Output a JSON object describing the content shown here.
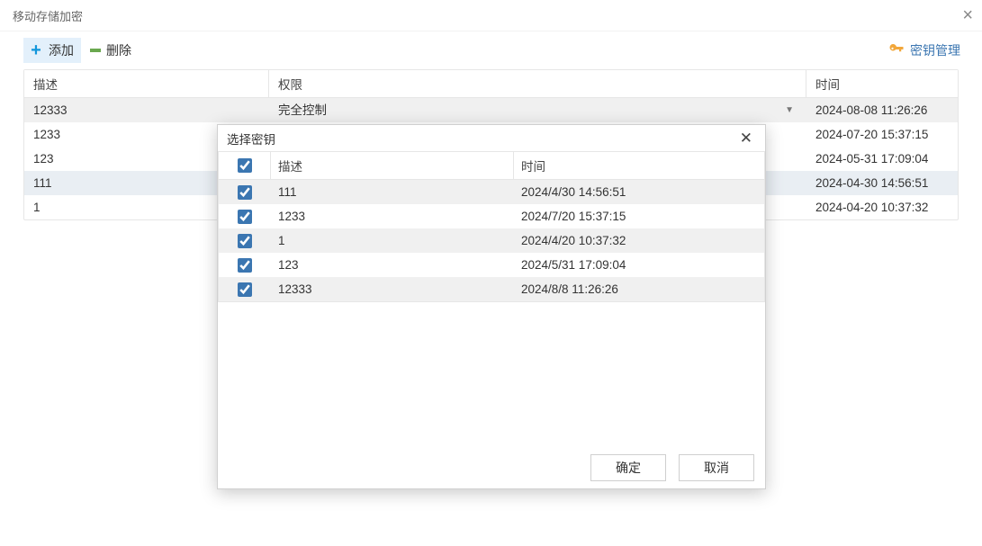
{
  "title": "移动存储加密",
  "toolbar": {
    "add_label": "添加",
    "delete_label": "删除",
    "key_manage_label": "密钥管理"
  },
  "table": {
    "columns": {
      "desc": "描述",
      "perm": "权限",
      "time": "时间"
    },
    "rows": [
      {
        "desc": "12333",
        "perm": "完全控制",
        "time": "2024-08-08 11:26:26",
        "selected": true,
        "perm_dropdown": true
      },
      {
        "desc": "1233",
        "perm": "",
        "time": "2024-07-20 15:37:15",
        "selected": false
      },
      {
        "desc": "123",
        "perm": "",
        "time": "2024-05-31 17:09:04",
        "selected": false
      },
      {
        "desc": "111",
        "perm": "",
        "time": "2024-04-30 14:56:51",
        "selected": false,
        "grey": true
      },
      {
        "desc": "1",
        "perm": "",
        "time": "2024-04-20 10:37:32",
        "selected": false
      }
    ]
  },
  "dialog": {
    "title": "选择密钥",
    "columns": {
      "checkbox": "",
      "desc": "描述",
      "time": "时间"
    },
    "rows": [
      {
        "checked": true,
        "desc": "111",
        "time": "2024/4/30 14:56:51"
      },
      {
        "checked": true,
        "desc": "1233",
        "time": "2024/7/20 15:37:15"
      },
      {
        "checked": true,
        "desc": "1",
        "time": "2024/4/20 10:37:32"
      },
      {
        "checked": true,
        "desc": "123",
        "time": "2024/5/31 17:09:04"
      },
      {
        "checked": true,
        "desc": "12333",
        "time": "2024/8/8 11:26:26"
      }
    ],
    "header_checked": true,
    "buttons": {
      "ok": "确定",
      "cancel": "取消"
    }
  }
}
